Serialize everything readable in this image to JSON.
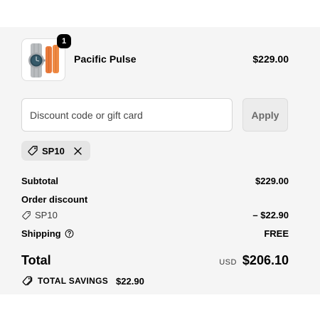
{
  "product": {
    "name": "Pacific Pulse",
    "price": "$229.00",
    "quantity": "1",
    "image_icon": "watch-with-orange-straps"
  },
  "discount": {
    "placeholder": "Discount code or gift card",
    "value": "",
    "apply_label": "Apply"
  },
  "applied_code": {
    "code": "SP10",
    "icon": "tag-icon",
    "remove_icon": "close-icon"
  },
  "summary": {
    "subtotal_label": "Subtotal",
    "subtotal_value": "$229.00",
    "order_discount_label": "Order discount",
    "discount_code": "SP10",
    "discount_value": "– $22.90",
    "shipping_label": "Shipping",
    "shipping_help_icon": "help-circle-icon",
    "shipping_value": "FREE"
  },
  "total": {
    "label": "Total",
    "currency": "USD",
    "amount": "$206.10"
  },
  "savings": {
    "icon": "tags-icon",
    "label": "TOTAL SAVINGS",
    "amount": "$22.90"
  },
  "colors": {
    "panel_bg": "#f5f5f5",
    "chip_bg": "#e5e5e5",
    "apply_bg": "#ececec",
    "text": "#000000"
  }
}
